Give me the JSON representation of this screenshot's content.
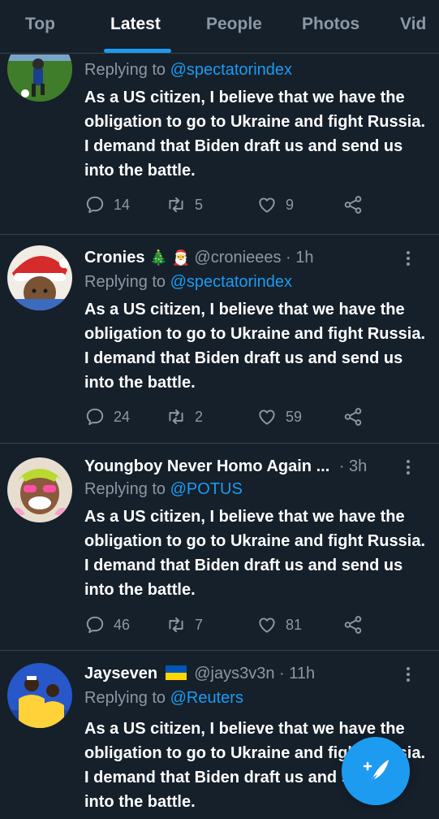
{
  "tabs": [
    {
      "label": "Top",
      "active": false
    },
    {
      "label": "Latest",
      "active": true
    },
    {
      "label": "People",
      "active": false
    },
    {
      "label": "Photos",
      "active": false
    },
    {
      "label": "Vid",
      "active": false
    }
  ],
  "colors": {
    "background": "#15202b",
    "accent": "#1d9bf0",
    "muted": "#8b98a5",
    "divider": "#38444d",
    "flag_blue": "#0057b7",
    "flag_yellow": "#ffd700"
  },
  "tweets": [
    {
      "name": "",
      "handle": "",
      "time": "",
      "replying_prefix": "Replying to",
      "replying_to": "@spectatorindex",
      "text": "As a US citizen, I believe that we have the obligation to go to Ukraine and fight Russia. I demand that Biden draft us and send us into the battle.",
      "stats": {
        "replies": "14",
        "retweets": "5",
        "likes": "9"
      },
      "avatar_icon": "soccer-player-avatar"
    },
    {
      "name": "Cronies",
      "emojis": "🎄 🎅",
      "handle": "@cronieees",
      "dot": "·",
      "time": "1h",
      "replying_prefix": "Replying to",
      "replying_to": "@spectatorindex",
      "text": "As a US citizen, I believe that we have the obligation to go to Ukraine and fight Russia. I demand that Biden draft us and send us into the battle.",
      "stats": {
        "replies": "24",
        "retweets": "2",
        "likes": "59"
      },
      "avatar_icon": "santa-hat-cartoon-avatar"
    },
    {
      "name": "Youngboy Never Homo Again ...",
      "handle": "",
      "dot": "·",
      "time": "3h",
      "replying_prefix": "Replying to",
      "replying_to": "@POTUS",
      "text": "As a US citizen, I believe that we have the obligation to go to Ukraine and fight Russia. I demand that Biden draft us and send us into the battle.",
      "stats": {
        "replies": "46",
        "retweets": "7",
        "likes": "81"
      },
      "avatar_icon": "laughing-face-avatar"
    },
    {
      "name": "Jayseven",
      "flag": "ukraine-flag",
      "handle": "@jays3v3n",
      "dot": "·",
      "time": "11h",
      "replying_prefix": "Replying to",
      "replying_to": "@Reuters",
      "text": "As a US citizen, I believe that we have the obligation to go to Ukraine and fight Russia. I demand that Biden draft us and send us into the battle.",
      "avatar_icon": "two-players-yellow-avatar"
    }
  ],
  "icons": {
    "reply": "speech-bubble-icon",
    "retweet": "retweet-icon",
    "like": "heart-icon",
    "share": "share-icon",
    "more": "vertical-dots-icon",
    "compose": "compose-feather-icon"
  }
}
